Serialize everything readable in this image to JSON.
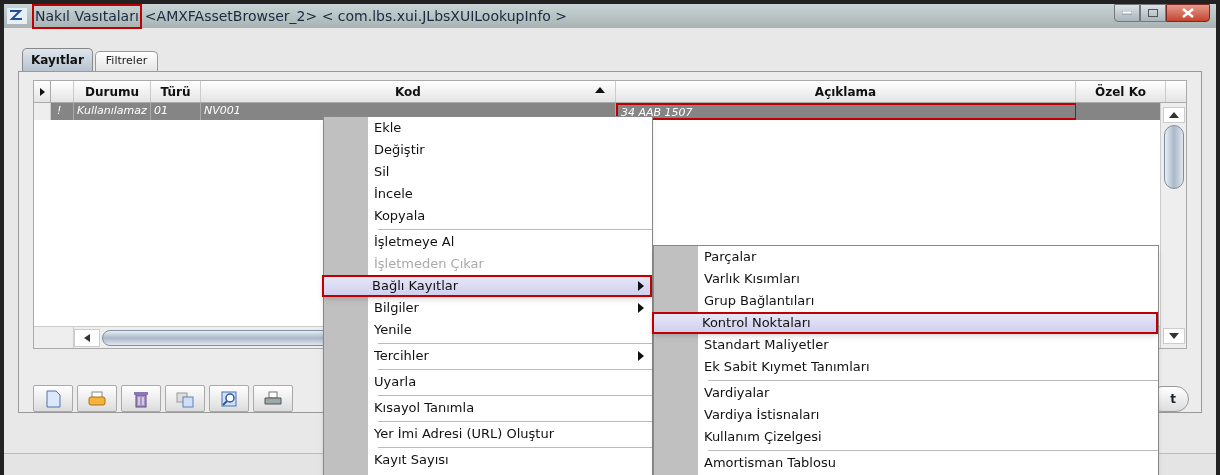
{
  "window": {
    "title": "Nakıl Vasıtaları",
    "subtitle": "<AMXFAssetBrowser_2> < com.lbs.xui.JLbsXUILookupInfo >",
    "title_annotated": true
  },
  "tabs": [
    {
      "label": "Kayıtlar",
      "selected": true
    },
    {
      "label": "Filtreler",
      "selected": false
    }
  ],
  "table": {
    "columns": [
      {
        "label": "Durumu",
        "sorted": false
      },
      {
        "label": "Türü",
        "sorted": false
      },
      {
        "label": "Kod",
        "sorted": true
      },
      {
        "label": "Açıklama",
        "sorted": false
      },
      {
        "label": "Özel Ko",
        "sorted": false
      }
    ],
    "rows": [
      {
        "flag": "!",
        "cells": [
          {
            "text": "Kullanılamaz",
            "annotated": false
          },
          {
            "text": "01",
            "annotated": false
          },
          {
            "text": "NV001",
            "annotated": false
          },
          {
            "text": "34 AAB 1507",
            "annotated": true
          }
        ],
        "selected": true
      }
    ]
  },
  "toolbar": {
    "buttons": [
      {
        "kind": "new"
      },
      {
        "kind": "open"
      },
      {
        "kind": "delete"
      },
      {
        "kind": "copy"
      },
      {
        "kind": "search"
      },
      {
        "kind": "print"
      }
    ],
    "partial_button": "t"
  },
  "context_menu": {
    "items": [
      {
        "kind": "item",
        "label": "Ekle",
        "selected": false,
        "disabled": false,
        "submenu": false
      },
      {
        "kind": "item",
        "label": "Değiştir",
        "selected": false,
        "disabled": false,
        "submenu": false
      },
      {
        "kind": "item",
        "label": "Sil",
        "selected": false,
        "disabled": false,
        "submenu": false
      },
      {
        "kind": "item",
        "label": "İncele",
        "selected": false,
        "disabled": false,
        "submenu": false
      },
      {
        "kind": "item",
        "label": "Kopyala",
        "selected": false,
        "disabled": false,
        "submenu": false
      },
      {
        "kind": "separator"
      },
      {
        "kind": "item",
        "label": "İşletmeye Al",
        "selected": false,
        "disabled": false,
        "submenu": false
      },
      {
        "kind": "item",
        "label": "İşletmeden Çıkar",
        "selected": false,
        "disabled": true,
        "submenu": false
      },
      {
        "kind": "item",
        "label": "Bağlı Kayıtlar",
        "selected": true,
        "disabled": false,
        "submenu": true
      },
      {
        "kind": "item",
        "label": "Bilgiler",
        "selected": false,
        "disabled": false,
        "submenu": true
      },
      {
        "kind": "item",
        "label": "Yenile",
        "selected": false,
        "disabled": false,
        "submenu": false
      },
      {
        "kind": "separator"
      },
      {
        "kind": "item",
        "label": "Tercihler",
        "selected": false,
        "disabled": false,
        "submenu": true
      },
      {
        "kind": "separator"
      },
      {
        "kind": "item",
        "label": "Uyarla",
        "selected": false,
        "disabled": false,
        "submenu": false
      },
      {
        "kind": "separator"
      },
      {
        "kind": "item",
        "label": "Kısayol Tanımla",
        "selected": false,
        "disabled": false,
        "submenu": false
      },
      {
        "kind": "separator"
      },
      {
        "kind": "item",
        "label": "Yer İmi Adresi (URL) Oluştur",
        "selected": false,
        "disabled": false,
        "submenu": false
      },
      {
        "kind": "separator"
      },
      {
        "kind": "item",
        "label": "Kayıt Sayısı",
        "selected": false,
        "disabled": false,
        "submenu": false
      }
    ]
  },
  "submenu": {
    "items": [
      {
        "kind": "item",
        "label": "Parçalar",
        "selected": false
      },
      {
        "kind": "item",
        "label": "Varlık Kısımları",
        "selected": false
      },
      {
        "kind": "item",
        "label": "Grup Bağlantıları",
        "selected": false
      },
      {
        "kind": "item",
        "label": "Kontrol Noktaları",
        "selected": true
      },
      {
        "kind": "item",
        "label": "Standart Maliyetler",
        "selected": false
      },
      {
        "kind": "item",
        "label": "Ek Sabit Kıymet Tanımları",
        "selected": false
      },
      {
        "kind": "separator"
      },
      {
        "kind": "item",
        "label": "Vardiyalar",
        "selected": false
      },
      {
        "kind": "item",
        "label": "Vardiya İstisnaları",
        "selected": false
      },
      {
        "kind": "item",
        "label": "Kullanım Çizelgesi",
        "selected": false
      },
      {
        "kind": "separator"
      },
      {
        "kind": "item",
        "label": "Amortisman Tablosu",
        "selected": false
      }
    ]
  }
}
